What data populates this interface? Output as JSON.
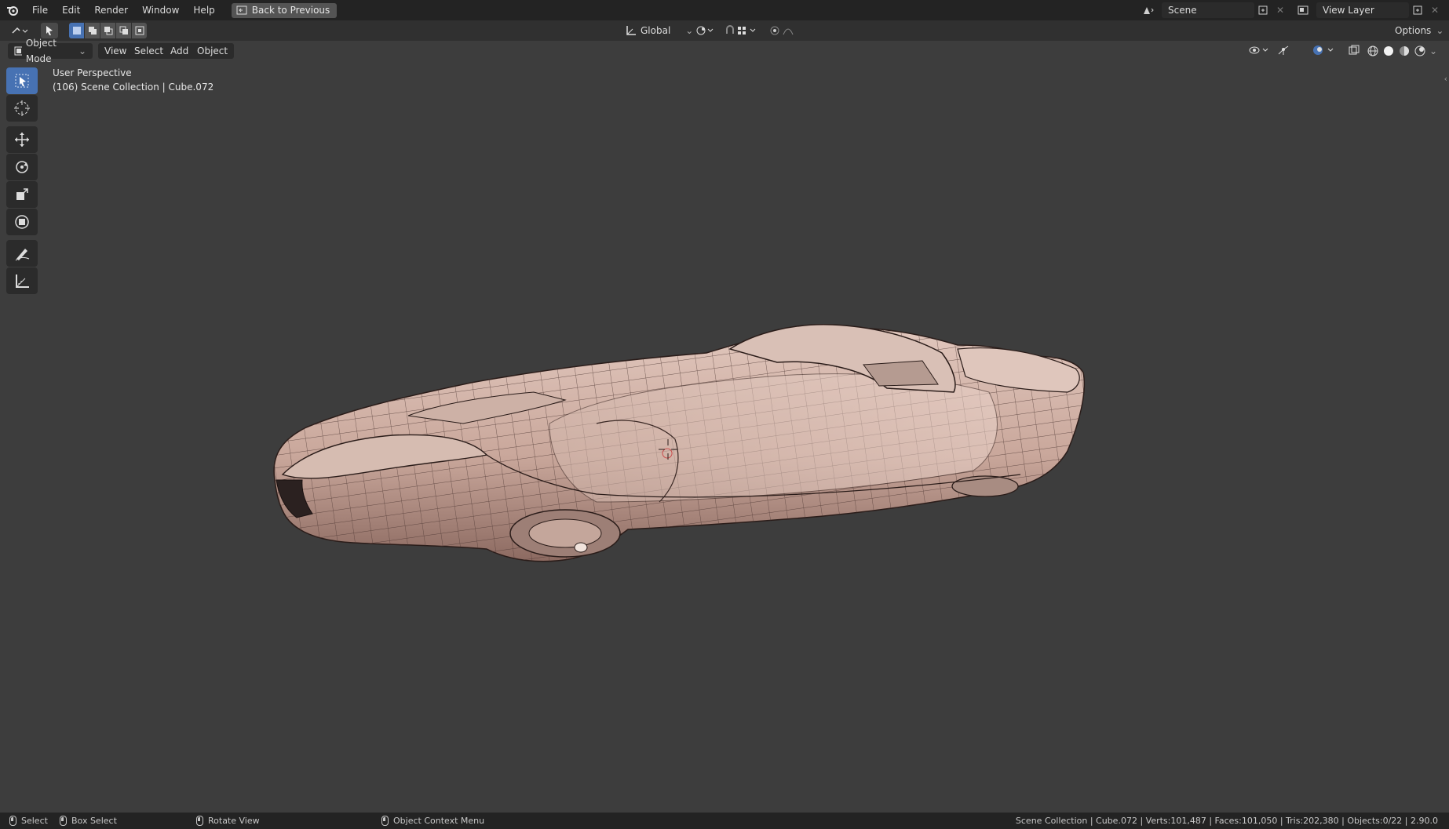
{
  "topbar": {
    "menus": [
      "File",
      "Edit",
      "Render",
      "Window",
      "Help"
    ],
    "back_button": "Back to Previous",
    "scene": "Scene",
    "view_layer": "View Layer"
  },
  "header": {
    "orientation": "Global",
    "options": "Options"
  },
  "viewport_header": {
    "mode": "Object Mode",
    "menus": [
      "View",
      "Select",
      "Add",
      "Object"
    ]
  },
  "viewport": {
    "perspective": "User Perspective",
    "collection_info": "(106) Scene Collection | Cube.072",
    "object": "sci-fi hover car mesh (wireframe overlay)"
  },
  "tools": [
    "select-box",
    "cursor",
    "move",
    "rotate",
    "scale",
    "transform",
    "annotate",
    "measure"
  ],
  "status": {
    "select": "Select",
    "box_select": "Box Select",
    "rotate_view": "Rotate View",
    "context_menu": "Object Context Menu",
    "stats": "Scene Collection | Cube.072 | Verts:101,487 | Faces:101,050 | Tris:202,380 | Objects:0/22 | 2.90.0"
  },
  "colors": {
    "viewport_bg": "#3d3d3d",
    "topbar_bg": "#232323",
    "active_tool": "#4772b3",
    "mesh": "#c9a79b"
  }
}
